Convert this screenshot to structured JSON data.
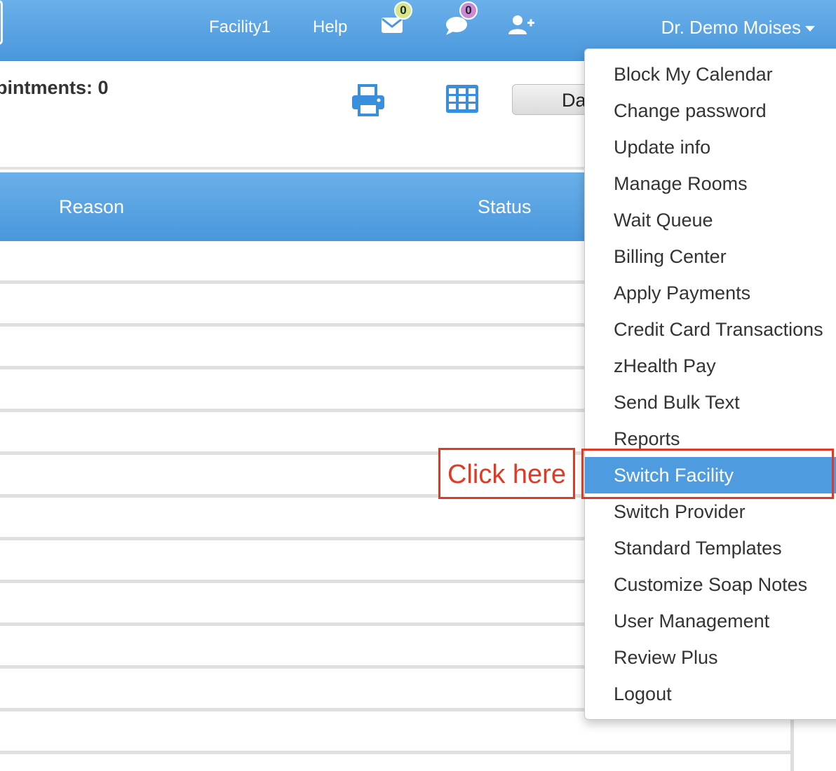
{
  "navbar": {
    "facility_label": "Facility1",
    "help_label": "Help",
    "messages_icon": "envelope-icon",
    "messages_count": "0",
    "messages_badge_color": "#d4e88a",
    "chat_icon": "chat-bubble-icon",
    "chat_count": "0",
    "chat_badge_color": "#c98bd6",
    "add_user_icon": "user-plus-icon",
    "user_name": "Dr. Demo Moises"
  },
  "toolbar": {
    "appointments_text": "pintments: 0",
    "print_icon": "printer-icon",
    "grid_icon": "grid-view-icon",
    "day_button_text": "Da"
  },
  "table": {
    "columns": [
      "Reason",
      "Status"
    ]
  },
  "annotation": {
    "text": "Click here",
    "color": "#e03a25"
  },
  "dropdown": {
    "items": [
      "Block My Calendar",
      "Change password",
      "Update info",
      "Manage Rooms",
      "Wait Queue",
      "Billing Center",
      "Apply Payments",
      "Credit Card Transactions",
      "zHealth Pay",
      "Send Bulk Text",
      "Reports",
      "Switch Facility",
      "Switch Provider",
      "Standard Templates",
      "Customize Soap Notes",
      "User Management",
      "Review Plus",
      "Logout"
    ],
    "active_item": "Switch Facility"
  },
  "colors": {
    "header_blue": "#4a97dc",
    "active_item_blue": "#4e9be0"
  }
}
